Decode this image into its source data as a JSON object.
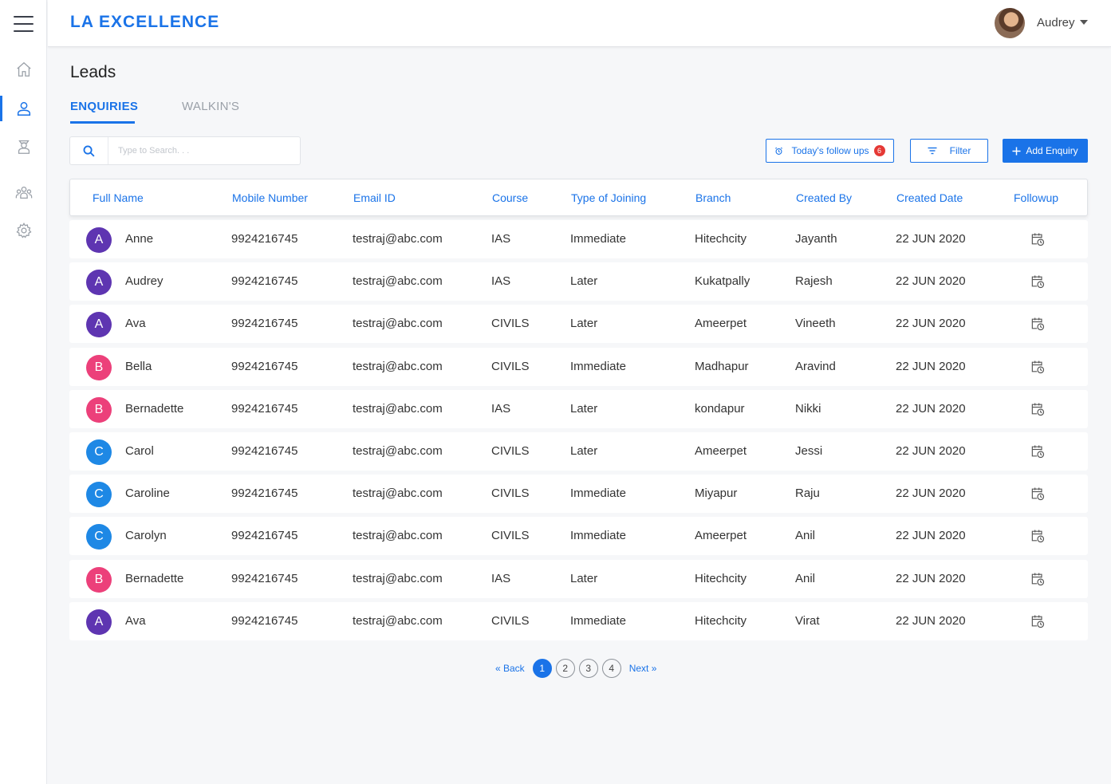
{
  "brand": "LA EXCELLENCE",
  "user": {
    "name": "Audrey"
  },
  "sidebar": {
    "items": [
      {
        "name": "home-icon",
        "active": false
      },
      {
        "name": "user-icon",
        "active": true
      },
      {
        "name": "student-icon",
        "active": false
      },
      {
        "name": "group-icon",
        "active": false
      },
      {
        "name": "settings-icon",
        "active": false
      }
    ]
  },
  "page": {
    "title": "Leads"
  },
  "tabs": {
    "enquiries": "ENQUIRIES",
    "walkins": "WALKIN'S"
  },
  "search": {
    "placeholder": "Type to Search. . ."
  },
  "toolbar": {
    "followups_label": "Today's follow ups",
    "followups_count": "6",
    "filter_label": "Filter",
    "add_label": "Add Enquiry"
  },
  "table": {
    "headers": [
      "Full Name",
      "Mobile Number",
      "Email ID",
      "Course",
      "Type of Joining",
      "Branch",
      "Created By",
      "Created Date",
      "Followup"
    ],
    "rows": [
      {
        "initial": "A",
        "color": "#5e35b1",
        "name": "Anne",
        "mobile": "9924216745",
        "email": "testraj@abc.com",
        "course": "IAS",
        "joining": "Immediate",
        "branch": "Hitechcity",
        "created_by": "Jayanth",
        "date": "22 JUN 2020"
      },
      {
        "initial": "A",
        "color": "#5e35b1",
        "name": "Audrey",
        "mobile": "9924216745",
        "email": "testraj@abc.com",
        "course": "IAS",
        "joining": "Later",
        "branch": "Kukatpally",
        "created_by": "Rajesh",
        "date": "22 JUN 2020"
      },
      {
        "initial": "A",
        "color": "#5e35b1",
        "name": "Ava",
        "mobile": "9924216745",
        "email": "testraj@abc.com",
        "course": "CIVILS",
        "joining": "Later",
        "branch": "Ameerpet",
        "created_by": "Vineeth",
        "date": "22 JUN 2020"
      },
      {
        "initial": "B",
        "color": "#ec407a",
        "name": "Bella",
        "mobile": "9924216745",
        "email": "testraj@abc.com",
        "course": "CIVILS",
        "joining": "Immediate",
        "branch": "Madhapur",
        "created_by": "Aravind",
        "date": "22 JUN 2020"
      },
      {
        "initial": "B",
        "color": "#ec407a",
        "name": "Bernadette",
        "mobile": "9924216745",
        "email": "testraj@abc.com",
        "course": "IAS",
        "joining": "Later",
        "branch": "kondapur",
        "created_by": "Nikki",
        "date": "22 JUN 2020"
      },
      {
        "initial": "C",
        "color": "#1e88e5",
        "name": "Carol",
        "mobile": "9924216745",
        "email": "testraj@abc.com",
        "course": "CIVILS",
        "joining": "Later",
        "branch": "Ameerpet",
        "created_by": "Jessi",
        "date": "22 JUN 2020"
      },
      {
        "initial": "C",
        "color": "#1e88e5",
        "name": "Caroline",
        "mobile": "9924216745",
        "email": "testraj@abc.com",
        "course": "CIVILS",
        "joining": "Immediate",
        "branch": "Miyapur",
        "created_by": "Raju",
        "date": "22 JUN 2020"
      },
      {
        "initial": "C",
        "color": "#1e88e5",
        "name": "Carolyn",
        "mobile": "9924216745",
        "email": "testraj@abc.com",
        "course": "CIVILS",
        "joining": "Immediate",
        "branch": "Ameerpet",
        "created_by": "Anil",
        "date": "22 JUN 2020"
      },
      {
        "initial": "B",
        "color": "#ec407a",
        "name": "Bernadette",
        "mobile": "9924216745",
        "email": "testraj@abc.com",
        "course": "IAS",
        "joining": "Later",
        "branch": "Hitechcity",
        "created_by": "Anil",
        "date": "22 JUN 2020"
      },
      {
        "initial": "A",
        "color": "#5e35b1",
        "name": "Ava",
        "mobile": "9924216745",
        "email": "testraj@abc.com",
        "course": "CIVILS",
        "joining": "Immediate",
        "branch": "Hitechcity",
        "created_by": "Virat",
        "date": "22 JUN 2020"
      }
    ]
  },
  "pagination": {
    "back_label": "« Back",
    "next_label": "Next »",
    "pages": [
      "1",
      "2",
      "3",
      "4"
    ],
    "current": "1"
  }
}
